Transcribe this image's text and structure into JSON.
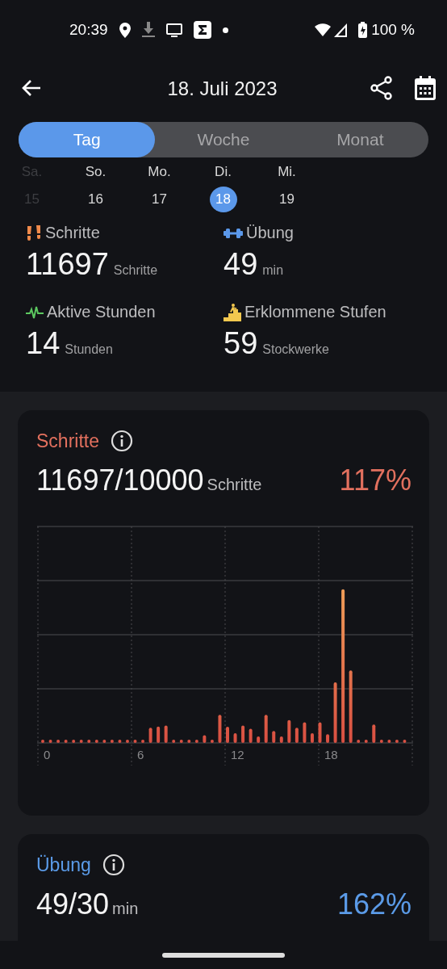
{
  "status_bar": {
    "time": "20:39",
    "battery": "100 %"
  },
  "header": {
    "title": "18. Juli 2023"
  },
  "tabs": [
    {
      "label": "Tag",
      "selected": true
    },
    {
      "label": "Woche",
      "selected": false
    },
    {
      "label": "Monat",
      "selected": false
    }
  ],
  "days": [
    {
      "weekday": "Sa.",
      "date": "15",
      "selected": false,
      "disabled": true
    },
    {
      "weekday": "So.",
      "date": "16",
      "selected": false,
      "disabled": false
    },
    {
      "weekday": "Mo.",
      "date": "17",
      "selected": false,
      "disabled": false
    },
    {
      "weekday": "Di.",
      "date": "18",
      "selected": true,
      "disabled": false
    },
    {
      "weekday": "Mi.",
      "date": "19",
      "selected": false,
      "disabled": false
    }
  ],
  "stats": [
    {
      "kind": "steps",
      "label": "Schritte",
      "value": "11697",
      "unit": "Schritte"
    },
    {
      "kind": "exercise",
      "label": "Übung",
      "value": "49",
      "unit": "min"
    },
    {
      "kind": "active",
      "label": "Aktive Stunden",
      "value": "14",
      "unit": "Stunden"
    },
    {
      "kind": "floors",
      "label": "Erklommene Stufen",
      "value": "59",
      "unit": "Stockwerke"
    }
  ],
  "cards": [
    {
      "title": "Schritte",
      "color": "#e2705e",
      "value": "11697/10000",
      "unit": "Schritte",
      "percent": "117%",
      "x_labels": [
        "0",
        "6",
        "12",
        "18"
      ]
    },
    {
      "title": "Übung",
      "color": "#5b9be8",
      "value": "49/30",
      "unit": "min",
      "percent": "162%"
    }
  ]
}
